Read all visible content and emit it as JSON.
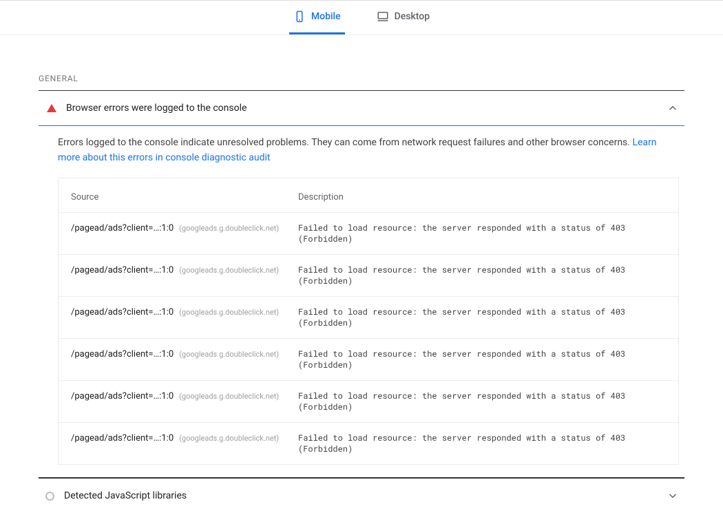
{
  "tabs": {
    "mobile": "Mobile",
    "desktop": "Desktop"
  },
  "section_label": "GENERAL",
  "audit_open": {
    "title": "Browser errors were logged to the console",
    "description_main": "Errors logged to the console indicate unresolved problems. They can come from network request failures and other browser concerns. ",
    "description_link": "Learn more about this errors in console diagnostic audit",
    "col_source": "Source",
    "col_description": "Description",
    "rows": [
      {
        "path": "/pagead/ads?client=…:1:0",
        "origin": "(googleads.g.doubleclick.net)",
        "desc": "Failed to load resource: the server responded with a status of 403 (Forbidden)"
      },
      {
        "path": "/pagead/ads?client=…:1:0",
        "origin": "(googleads.g.doubleclick.net)",
        "desc": "Failed to load resource: the server responded with a status of 403 (Forbidden)"
      },
      {
        "path": "/pagead/ads?client=…:1:0",
        "origin": "(googleads.g.doubleclick.net)",
        "desc": "Failed to load resource: the server responded with a status of 403 (Forbidden)"
      },
      {
        "path": "/pagead/ads?client=…:1:0",
        "origin": "(googleads.g.doubleclick.net)",
        "desc": "Failed to load resource: the server responded with a status of 403 (Forbidden)"
      },
      {
        "path": "/pagead/ads?client=…:1:0",
        "origin": "(googleads.g.doubleclick.net)",
        "desc": "Failed to load resource: the server responded with a status of 403 (Forbidden)"
      },
      {
        "path": "/pagead/ads?client=…:1:0",
        "origin": "(googleads.g.doubleclick.net)",
        "desc": "Failed to load resource: the server responded with a status of 403 (Forbidden)"
      }
    ]
  },
  "audit_collapsed": {
    "title": "Detected JavaScript libraries"
  }
}
